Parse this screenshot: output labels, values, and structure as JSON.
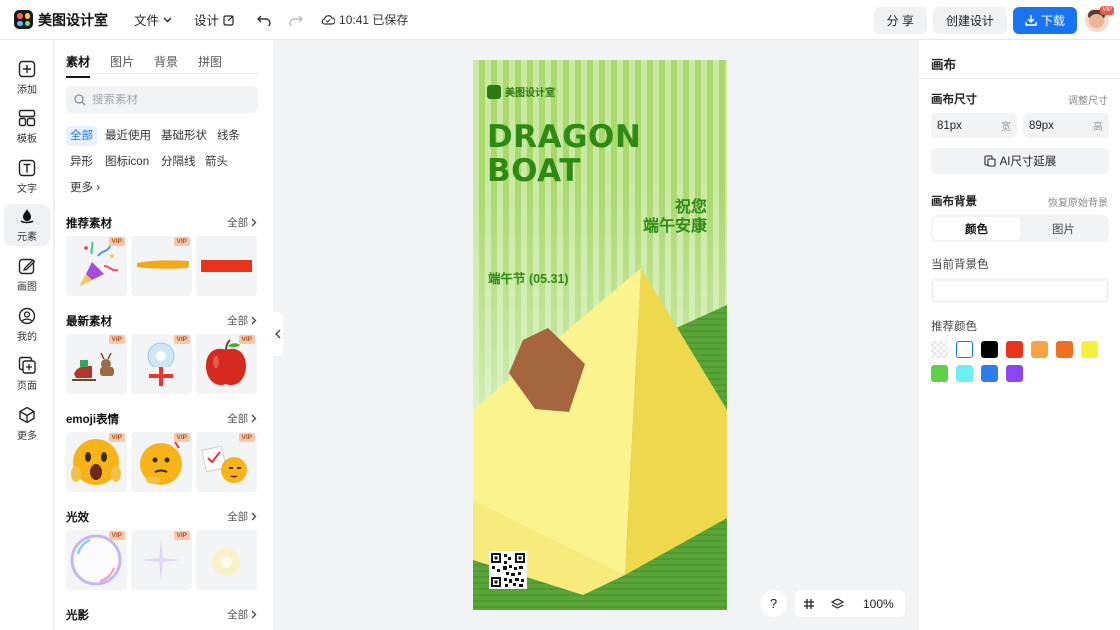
{
  "app": {
    "name": "美图设计室",
    "menu": {
      "file": "文件",
      "design": "设计"
    },
    "save_status": "10:41 已保存",
    "share": "分 享",
    "create": "创建设计",
    "download": "下载",
    "avatar_badge": "VIP"
  },
  "rail": {
    "items": [
      {
        "label": "添加",
        "icon": "add-icon"
      },
      {
        "label": "模板",
        "icon": "template-icon"
      },
      {
        "label": "文字",
        "icon": "text-icon"
      },
      {
        "label": "元素",
        "icon": "element-icon",
        "active": true
      },
      {
        "label": "画图",
        "icon": "draw-icon"
      },
      {
        "label": "我的",
        "icon": "user-icon"
      },
      {
        "label": "页面",
        "icon": "page-icon"
      },
      {
        "label": "更多",
        "icon": "more-icon"
      }
    ]
  },
  "panel": {
    "tabs": [
      "素材",
      "图片",
      "背景",
      "拼图"
    ],
    "search_placeholder": "搜索素材",
    "chips": [
      "全部",
      "最近使用",
      "基础形状",
      "线条",
      "异形",
      "图标icon",
      "分隔线",
      "箭头",
      "更多"
    ],
    "all_label": "全部",
    "vip": "VIP",
    "sections": [
      {
        "title": "推荐素材"
      },
      {
        "title": "最新素材"
      },
      {
        "title": "emoji表情"
      },
      {
        "title": "光效"
      },
      {
        "title": "光影"
      }
    ]
  },
  "poster": {
    "brand": "美图设计室",
    "title_line1": "DRAGON",
    "title_line2": "BOAT",
    "wish_line1": "祝您",
    "wish_line2": "端午安康",
    "date": "端午节 (05.31)"
  },
  "controls": {
    "help": "?",
    "zoom": "100%"
  },
  "right_panel": {
    "title": "画布",
    "size_label": "画布尺寸",
    "adjust_size": "调整尺寸",
    "width_value": "81px",
    "width_unit": "宽",
    "height_value": "89px",
    "height_unit": "高",
    "ai_extend": "AI尺寸延展",
    "bg_label": "画布背景",
    "restore_bg": "恢复原始背景",
    "seg_color": "颜色",
    "seg_image": "图片",
    "current_bg_label": "当前背景色",
    "recommended_label": "推荐颜色",
    "swatches": [
      "transparent",
      "#ffffff",
      "#000000",
      "#e8341c",
      "#f5a545",
      "#f07020",
      "#f5f03c",
      "#5fd04a",
      "#6ff0f0",
      "#2f7cf0",
      "#8a46f0"
    ]
  },
  "colors": {
    "accent": "#1a73f0",
    "poster_green": "#2e8a14"
  }
}
